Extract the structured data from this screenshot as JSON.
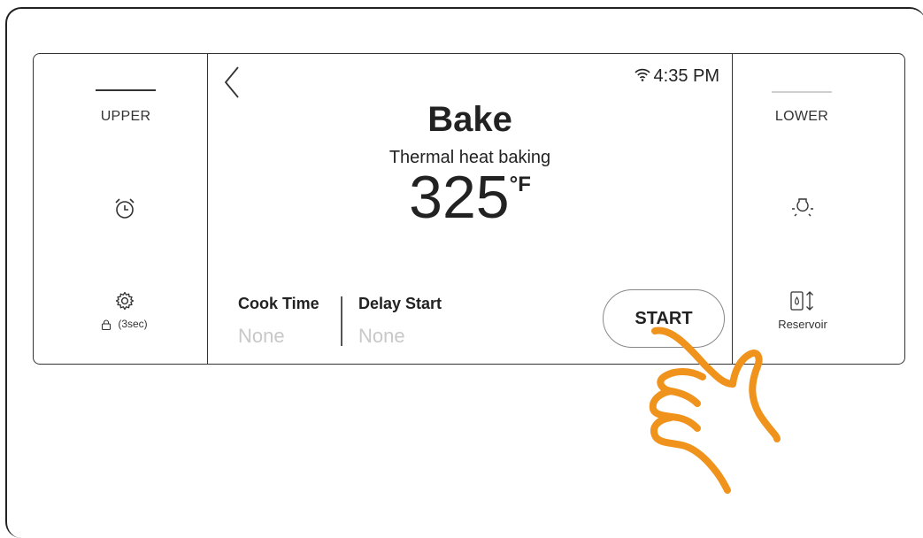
{
  "left_panel": {
    "upper_label": "UPPER",
    "lock_label": "(3sec)"
  },
  "right_panel": {
    "lower_label": "LOWER",
    "reservoir_label": "Reservoir"
  },
  "screen": {
    "time": "4:35 PM",
    "mode_title": "Bake",
    "mode_subtitle": "Thermal heat baking",
    "temperature": "325",
    "temperature_unit": "°F",
    "cook_time_label": "Cook Time",
    "cook_time_value": "None",
    "delay_start_label": "Delay Start",
    "delay_start_value": "None",
    "start_label": "START"
  },
  "colors": {
    "accent_hand": "#f0931c",
    "inactive_value": "#c8c8c8"
  },
  "icons": [
    "back-chevron-icon",
    "wifi-icon",
    "alarm-clock-icon",
    "gear-icon",
    "lock-icon",
    "oven-light-icon",
    "reservoir-icon",
    "pointing-hand-icon"
  ]
}
